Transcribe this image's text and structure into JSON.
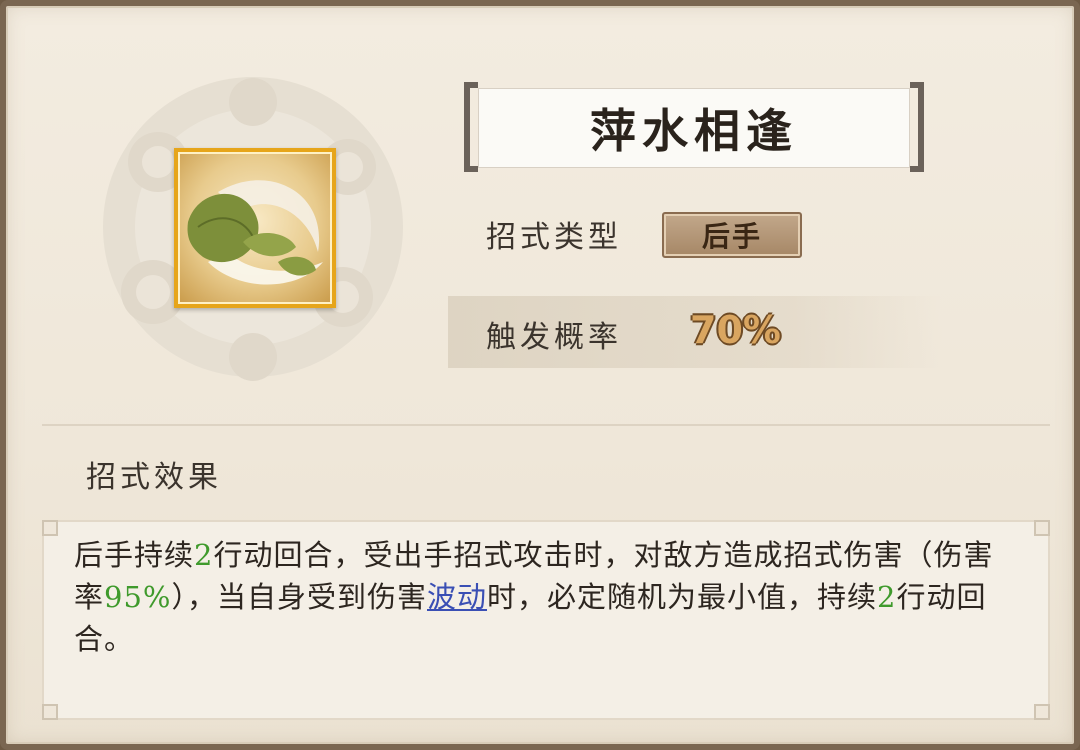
{
  "skill": {
    "name": "萍水相逢",
    "icon": "leaf-wind-icon",
    "type_label": "招式类型",
    "type_value": "后手",
    "rate_label": "触发概率",
    "rate_value": "70%"
  },
  "effect": {
    "heading": "招式效果",
    "segments": [
      {
        "text": "后手持续"
      },
      {
        "text": "2",
        "style": "num"
      },
      {
        "text": "行动回合，受出手招式攻击时，对敌方造成招式伤害（伤害率"
      },
      {
        "text": "95%",
        "style": "num"
      },
      {
        "text": "），当自身受到伤害"
      },
      {
        "text": "波动",
        "style": "link"
      },
      {
        "text": "时，必定随机为最小值，持续"
      },
      {
        "text": "2",
        "style": "num"
      },
      {
        "text": "行动回合。"
      }
    ]
  },
  "colors": {
    "number_highlight": "#3f9a2c",
    "link_highlight": "#3a4fb4",
    "icon_border": "#e6a51a"
  }
}
